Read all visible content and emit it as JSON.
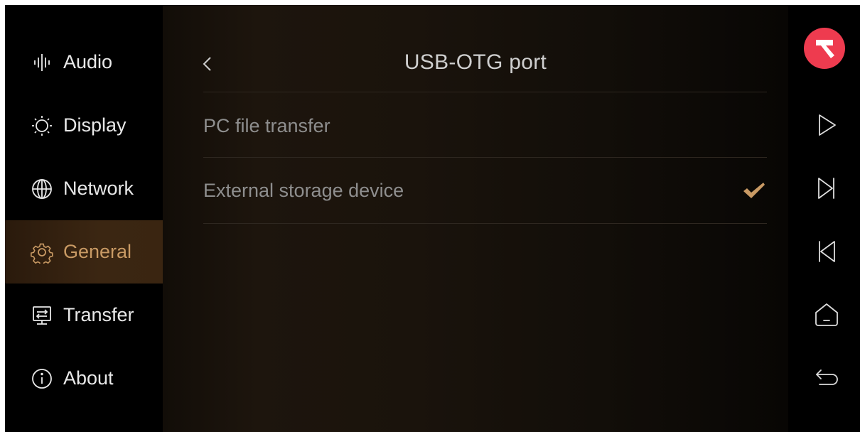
{
  "sidebar": {
    "items": [
      {
        "label": "Audio",
        "icon": "audio-levels-icon"
      },
      {
        "label": "Display",
        "icon": "sun-icon"
      },
      {
        "label": "Network",
        "icon": "globe-icon"
      },
      {
        "label": "General",
        "icon": "gear-icon",
        "active": true
      },
      {
        "label": "Transfer",
        "icon": "monitor-transfer-icon"
      },
      {
        "label": "About",
        "icon": "info-icon"
      }
    ]
  },
  "main": {
    "title": "USB-OTG port",
    "options": [
      {
        "label": "PC file transfer",
        "selected": false
      },
      {
        "label": "External storage device",
        "selected": true
      }
    ]
  },
  "rightbar": {
    "logo": "app-logo-icon",
    "buttons": [
      "play-icon",
      "next-track-icon",
      "previous-track-icon",
      "home-icon",
      "return-icon"
    ]
  },
  "colors": {
    "accent": "#c99a64",
    "logo_bg": "#ee3b4f",
    "text_primary": "#e8e8e8",
    "text_secondary": "#8e8e8e"
  }
}
